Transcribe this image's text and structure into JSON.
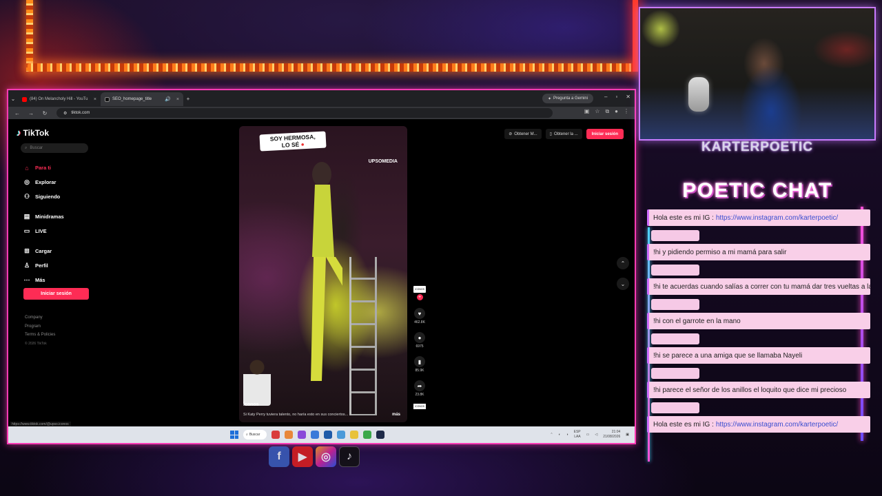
{
  "browser": {
    "tabs": [
      {
        "label": "(84) On Melancholy Hill - YouTu",
        "active": false,
        "favicon_color": "#ff0000"
      },
      {
        "label": "SEO_homepage_title",
        "active": true,
        "favicon_color": "#111111"
      }
    ],
    "gemini_label": "Pregunta a Gemini",
    "url": "tiktok.com",
    "status_url": "https://www.tiktok.com/@upso.iconos"
  },
  "tiktok": {
    "logo": "TikTok",
    "search_placeholder": "Buscar",
    "nav": [
      {
        "label": "Para ti",
        "icon": "home-icon",
        "active": true
      },
      {
        "label": "Explorar",
        "icon": "compass-icon",
        "active": false
      },
      {
        "label": "Siguiendo",
        "icon": "following-icon",
        "active": false
      },
      {
        "label": "Minidramas",
        "icon": "minidramas-icon",
        "active": false
      },
      {
        "label": "LIVE",
        "icon": "live-icon",
        "active": false
      },
      {
        "label": "Cargar",
        "icon": "upload-icon",
        "active": false
      },
      {
        "label": "Perfil",
        "icon": "profile-icon",
        "active": false
      },
      {
        "label": "Más",
        "icon": "more-icon",
        "active": false
      }
    ],
    "login_side": "Iniciar sesión",
    "footer": {
      "company": "Company",
      "program": "Program",
      "terms": "Terms & Policies",
      "copyright": "© 2026 TikTok"
    },
    "top_buttons": {
      "get_coins": "Obtener M...",
      "get_app": "Obtener la ...",
      "login": "Iniciar sesión"
    },
    "video": {
      "caption_top_line1": "SOY HERMOSA,",
      "caption_top_line2": "LO SÉ",
      "brand": "UPSOMEDIA",
      "username": "Íconos",
      "description": "Si Katy Perry tuviera talento, no haría esto en sus conciertos... ",
      "more": "más"
    },
    "actions": {
      "avatar_label": "ICONOS",
      "likes": "462.8K",
      "comments": "6975",
      "saves": "85.9K",
      "shares": "23.8K",
      "disc_label": "ICONOS"
    }
  },
  "taskbar": {
    "search": "Buscar",
    "lang_top": "ESP",
    "lang_bottom": "LAA",
    "time": "21:04",
    "date": "21/08/2026"
  },
  "stream": {
    "streamer_name": "KARTERPOETIC",
    "chat_title": "POETIC CHAT",
    "messages": [
      {
        "text": "Hola este es mi IG : ",
        "link": "https://www.instagram.com/karterpoetic/",
        "show_user": false
      },
      {
        "text": "!hi y pidiendo permiso a mi mamá para salir",
        "link": "",
        "show_user": true
      },
      {
        "text": "!hi te acuerdas cuando salías a correr con tu mamá dar tres vueltas a la cuadra",
        "link": "",
        "show_user": true
      },
      {
        "text": "!hi con el garrote en la mano",
        "link": "",
        "show_user": true
      },
      {
        "text": "!hi se parece a una amiga que se llamaba Nayeli",
        "link": "",
        "show_user": true
      },
      {
        "text": "!hi parece el señor de los anillos el loquito que dice mi precioso",
        "link": "",
        "show_user": true
      },
      {
        "text": "Hola este es mi IG : ",
        "link": "https://www.instagram.com/karterpoetic/",
        "show_user": true
      }
    ]
  },
  "colors": {
    "tiktok_red": "#fe2c55",
    "neon_pink": "#ff3bb5",
    "chat_bubble": "#f9cfe8"
  }
}
